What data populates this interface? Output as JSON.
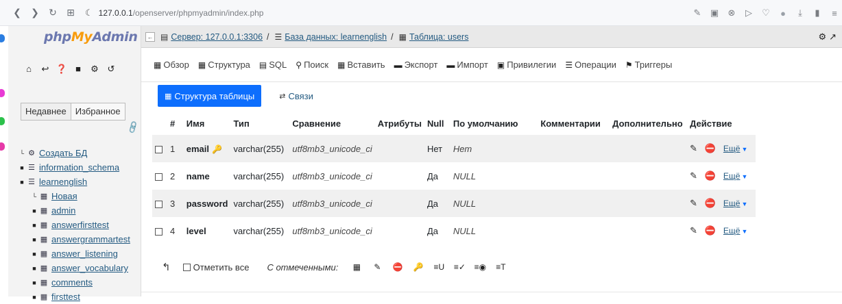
{
  "browser": {
    "url_host": "127.0.0.1",
    "url_path": "/openserver/phpmyadmin/index.php"
  },
  "sidebar": {
    "logo": {
      "php": "php",
      "my": "My",
      "admin": "Admin"
    },
    "tabs": [
      "Недавнее",
      "Избранное"
    ],
    "tree": [
      {
        "label": "Создать БД",
        "icon": "new-db-icon",
        "level": 1
      },
      {
        "label": "information_schema",
        "icon": "database-icon",
        "level": 1
      },
      {
        "label": "learnenglish",
        "icon": "database-icon",
        "level": 1
      },
      {
        "label": "Новая",
        "icon": "new-table-icon",
        "level": 2
      },
      {
        "label": "admin",
        "icon": "table-icon",
        "level": 2
      },
      {
        "label": "answerfirsttest",
        "icon": "table-icon",
        "level": 2
      },
      {
        "label": "answergrammartest",
        "icon": "table-icon",
        "level": 2
      },
      {
        "label": "answer_listening",
        "icon": "table-icon",
        "level": 2
      },
      {
        "label": "answer_vocabulary",
        "icon": "table-icon",
        "level": 2
      },
      {
        "label": "comments",
        "icon": "table-icon",
        "level": 2
      },
      {
        "label": "firsttest",
        "icon": "table-icon",
        "level": 2
      }
    ]
  },
  "breadcrumb": {
    "server": "Сервер: 127.0.0.1:3306",
    "database": "База данных: learnenglish",
    "table": "Таблица: users"
  },
  "menu": [
    {
      "label": "Обзор",
      "icon": "browse-icon"
    },
    {
      "label": "Структура",
      "icon": "structure-icon"
    },
    {
      "label": "SQL",
      "icon": "sql-icon"
    },
    {
      "label": "Поиск",
      "icon": "search-icon"
    },
    {
      "label": "Вставить",
      "icon": "insert-icon"
    },
    {
      "label": "Экспорт",
      "icon": "export-icon"
    },
    {
      "label": "Импорт",
      "icon": "import-icon"
    },
    {
      "label": "Привилегии",
      "icon": "privileges-icon"
    },
    {
      "label": "Операции",
      "icon": "operations-icon"
    },
    {
      "label": "Триггеры",
      "icon": "triggers-icon"
    }
  ],
  "subtabs": {
    "active": "Структура таблицы",
    "other": "Связи"
  },
  "table": {
    "headers": [
      "#",
      "Имя",
      "Тип",
      "Сравнение",
      "Атрибуты",
      "Null",
      "По умолчанию",
      "Комментарии",
      "Дополнительно",
      "Действие"
    ],
    "rows": [
      {
        "num": "1",
        "name": "email",
        "type": "varchar(255)",
        "collation": "utf8mb3_unicode_ci",
        "attributes": "",
        "null": "Нет",
        "default": "Нет",
        "comments": "",
        "extra": "",
        "more": "Ещё"
      },
      {
        "num": "2",
        "name": "name",
        "type": "varchar(255)",
        "collation": "utf8mb3_unicode_ci",
        "attributes": "",
        "null": "Да",
        "default": "NULL",
        "comments": "",
        "extra": "",
        "more": "Ещё"
      },
      {
        "num": "3",
        "name": "password",
        "type": "varchar(255)",
        "collation": "utf8mb3_unicode_ci",
        "attributes": "",
        "null": "Да",
        "default": "NULL",
        "comments": "",
        "extra": "",
        "more": "Ещё"
      },
      {
        "num": "4",
        "name": "level",
        "type": "varchar(255)",
        "collation": "utf8mb3_unicode_ci",
        "attributes": "",
        "null": "Да",
        "default": "NULL",
        "comments": "",
        "extra": "",
        "more": "Ещё"
      }
    ]
  },
  "bottom": {
    "select_all": "Отметить все",
    "with_selected": "С отмеченными:"
  },
  "colors": {
    "accent": "#0d6efd",
    "link": "#235a81",
    "row_alt": "#f0f0f0"
  }
}
